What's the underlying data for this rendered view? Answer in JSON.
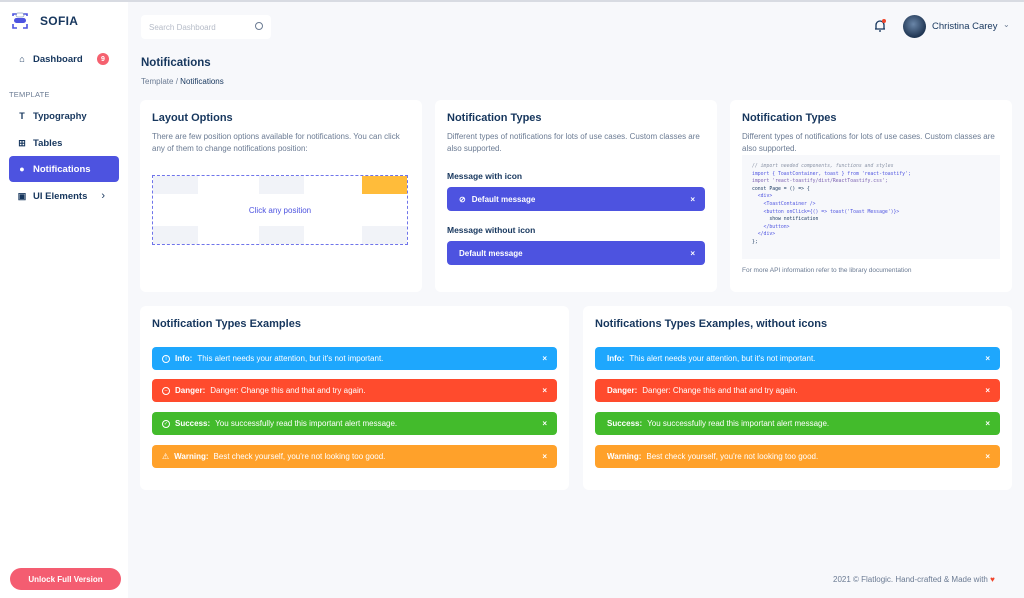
{
  "app": {
    "name": "SOFIA"
  },
  "sidebar": {
    "items": [
      {
        "label": "Dashboard",
        "icon": "home-icon",
        "badge": "9"
      },
      {
        "label": "Typography",
        "icon": "type-icon"
      },
      {
        "label": "Tables",
        "icon": "grid-icon"
      },
      {
        "label": "Notifications",
        "icon": "bell-icon",
        "active": true
      },
      {
        "label": "UI Elements",
        "icon": "chart-icon"
      }
    ],
    "section_label": "TEMPLATE",
    "unlock_label": "Unlock Full Version"
  },
  "header": {
    "search_placeholder": "Search Dashboard",
    "user_name": "Christina Carey"
  },
  "page": {
    "title": "Notifications",
    "breadcrumb": {
      "parent": "Template",
      "sep": "/",
      "current": "Notifications"
    }
  },
  "layout_options": {
    "title": "Layout Options",
    "desc": "There are few position options available for notifications. You can click any of them to change notifications position:",
    "caption": "Click any position",
    "selected": "top-right"
  },
  "notification_types": {
    "title": "Notification Types",
    "desc": "Different types of notifications for lots of use cases. Custom classes are also supported.",
    "with_icon_label": "Message with icon",
    "without_icon_label": "Message without icon",
    "message": "Default message",
    "close": "×"
  },
  "code_card": {
    "title": "Notification Types",
    "desc": "Different types of notifications for lots of use cases. Custom classes are also supported.",
    "code": [
      "// import needed components, functions and styles",
      "import { ToastContainer, toast } from 'react-toastify';",
      "import 'react-toastify/dist/ReactToastify.css';",
      "",
      "const Page = () => {",
      "  <div>",
      "    <ToastContainer />",
      "    <button onClick={() => toast('Toast Message')}>",
      "      show notification",
      "    </button>",
      "  </div>",
      "};"
    ],
    "api_note": "For more API information refer to the library documentation"
  },
  "examples": {
    "title": "Notification Types Examples",
    "title_no_icons": "Notifications Types Examples, without icons",
    "alerts": [
      {
        "type": "info",
        "label": "Info:",
        "text": "This alert needs your attention, but it's not important.",
        "icon": "ⓘ"
      },
      {
        "type": "danger",
        "label": "Danger:",
        "text": "Danger: Change this and that and try again.",
        "icon": "⊝"
      },
      {
        "type": "success",
        "label": "Success:",
        "text": "You successfully read this important alert message.",
        "icon": "✓"
      },
      {
        "type": "warning",
        "label": "Warning:",
        "text": "Best check yourself, you're not looking too good.",
        "icon": "⚠"
      }
    ],
    "close": "×"
  },
  "footer": {
    "text": "2021 © Flatlogic. Hand-crafted & Made with",
    "heart": "♥"
  }
}
